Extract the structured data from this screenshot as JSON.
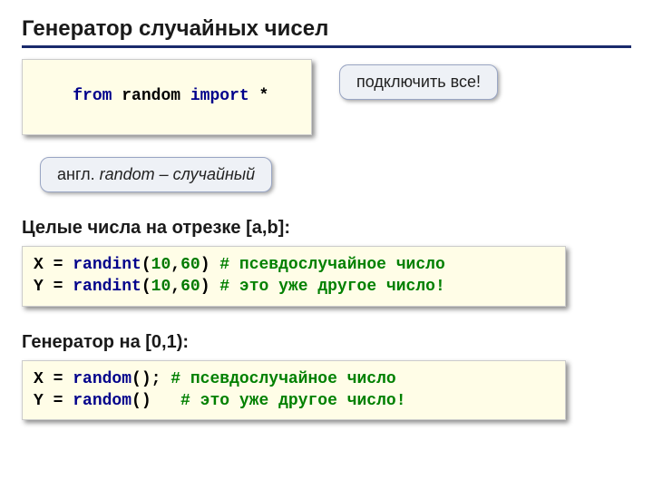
{
  "title": "Генератор случайных чисел",
  "import": {
    "kw_from": "from",
    "module": "random",
    "kw_import": "import",
    "star": "*"
  },
  "callout1": "подключить все!",
  "callout2_pre": "англ. ",
  "callout2_it": "random – случайный",
  "section1": "Целые числа на отрезке [a,b]:",
  "code1": {
    "l1_v": "X",
    "eq": " = ",
    "fn1": "randint",
    "l1_args_open": "(",
    "n1a": "10",
    "comma": ",",
    "n1b": "60",
    "l1_args_close": ")",
    "c1": " # псевдослучайное число",
    "l2_v": "Y",
    "c2": " # это уже другое число!"
  },
  "section2": "Генератор на [0,1):",
  "code2": {
    "l1_v": "X",
    "eq": " = ",
    "fn": "random",
    "paren": "()",
    "semi": ";",
    "c1": " # псевдослучайное число",
    "l2_v": "Y",
    "sp": "  ",
    "c2": " # это уже другое число!"
  }
}
